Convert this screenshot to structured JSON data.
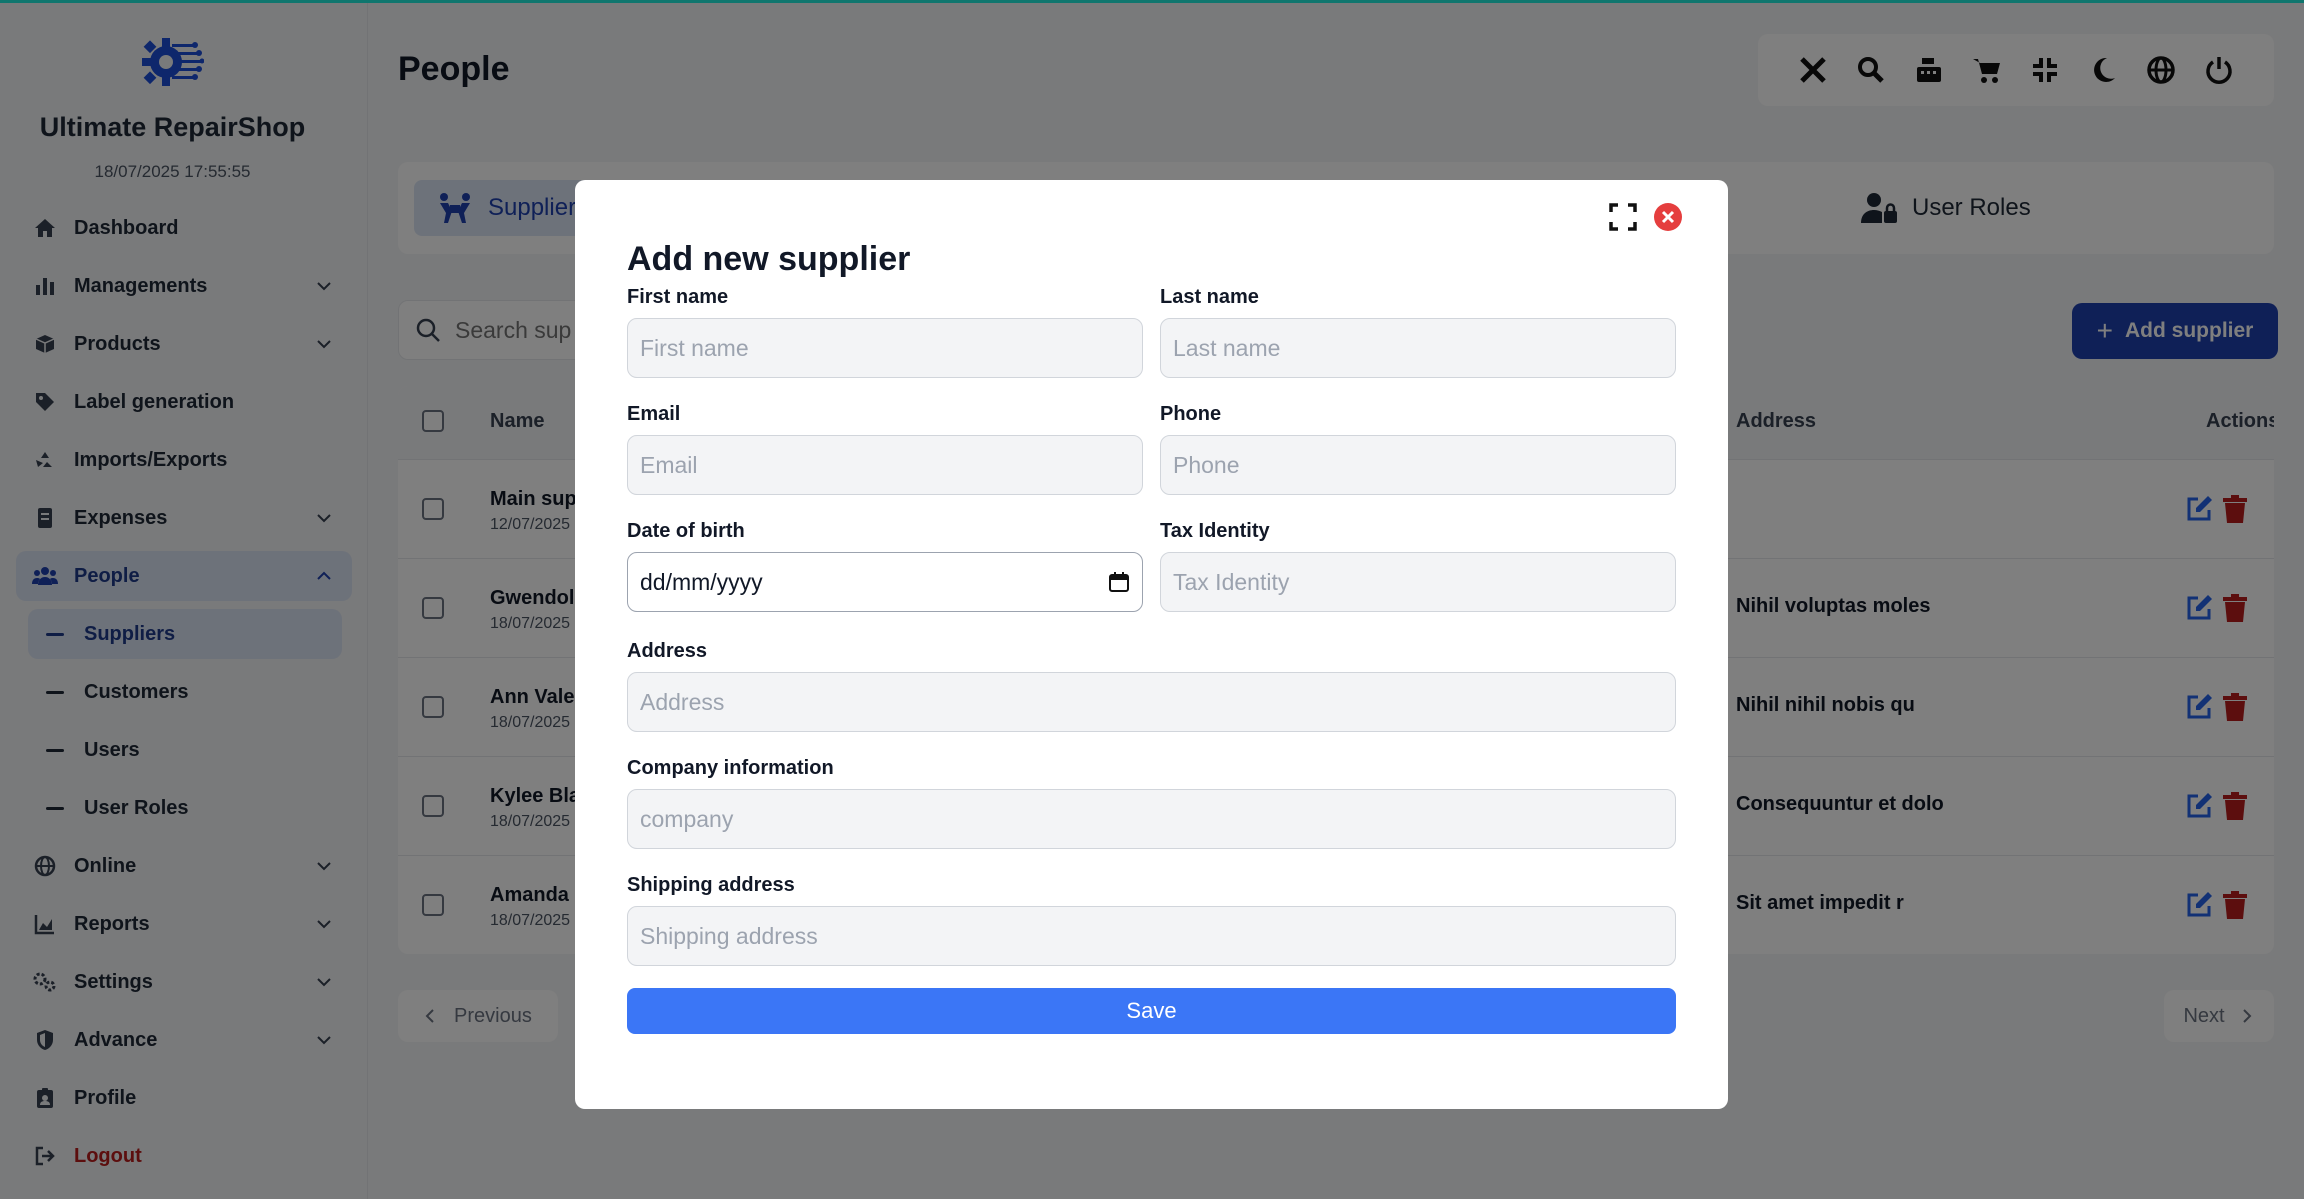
{
  "app": {
    "name": "Ultimate RepairShop",
    "datetime": "18/07/2025 17:55:55"
  },
  "sidebar": {
    "items": [
      {
        "label": "Dashboard",
        "icon": "home-icon"
      },
      {
        "label": "Managements",
        "icon": "bar-chart-icon"
      },
      {
        "label": "Products",
        "icon": "box-icon"
      },
      {
        "label": "Label generation",
        "icon": "tag-icon"
      },
      {
        "label": "Imports/Exports",
        "icon": "recycle-icon"
      },
      {
        "label": "Expenses",
        "icon": "receipt-icon"
      },
      {
        "label": "People",
        "icon": "users-icon"
      },
      {
        "label": "Online",
        "icon": "globe-icon"
      },
      {
        "label": "Reports",
        "icon": "area-chart-icon"
      },
      {
        "label": "Settings",
        "icon": "gears-icon"
      },
      {
        "label": "Advance",
        "icon": "shield-icon"
      },
      {
        "label": "Profile",
        "icon": "id-badge-icon"
      },
      {
        "label": "Logout",
        "icon": "logout-icon"
      }
    ],
    "people_sub": [
      "Suppliers",
      "Customers",
      "Users",
      "User Roles"
    ]
  },
  "page": {
    "title": "People"
  },
  "toolbar": [
    "tools-icon",
    "search-zoom-icon",
    "cash-register-icon",
    "cart-icon",
    "compress-icon",
    "moon-icon",
    "globe-icon",
    "power-icon"
  ],
  "tabs": {
    "suppliers": "Supplier",
    "user_roles": "User Roles"
  },
  "search": {
    "placeholder": "Search sup"
  },
  "add_button": "Add supplier",
  "table": {
    "headers": {
      "name": "Name",
      "address": "Address",
      "actions": "Actions"
    },
    "rows": [
      {
        "name": "Main sup",
        "date": "12/07/2025",
        "address": ""
      },
      {
        "name": "Gwendol",
        "date": "18/07/2025",
        "address": "Nihil voluptas moles"
      },
      {
        "name": "Ann Vale",
        "date": "18/07/2025",
        "address": "Nihil nihil nobis qu"
      },
      {
        "name": "Kylee Bla",
        "date": "18/07/2025",
        "address": "Consequuntur et dolo"
      },
      {
        "name": "Amanda",
        "date": "18/07/2025",
        "address": "Sit amet impedit r"
      }
    ]
  },
  "pager": {
    "previous": "Previous",
    "next": "Next"
  },
  "modal": {
    "title": "Add new supplier",
    "fields": {
      "first_name": {
        "label": "First name",
        "placeholder": "First name"
      },
      "last_name": {
        "label": "Last name",
        "placeholder": "Last name"
      },
      "email": {
        "label": "Email",
        "placeholder": "Email"
      },
      "phone": {
        "label": "Phone",
        "placeholder": "Phone"
      },
      "dob": {
        "label": "Date of birth",
        "value": "dd/mm/yyyy"
      },
      "tax": {
        "label": "Tax Identity",
        "placeholder": "Tax Identity"
      },
      "address": {
        "label": "Address",
        "placeholder": "Address"
      },
      "company": {
        "label": "Company information",
        "placeholder": "company"
      },
      "shipping": {
        "label": "Shipping address",
        "placeholder": "Shipping address"
      }
    },
    "save": "Save"
  },
  "colors": {
    "primary": "#1e40af",
    "save": "#3b76f6",
    "danger": "#b91c1c",
    "close": "#e53e3e",
    "edit": "#2563eb"
  }
}
